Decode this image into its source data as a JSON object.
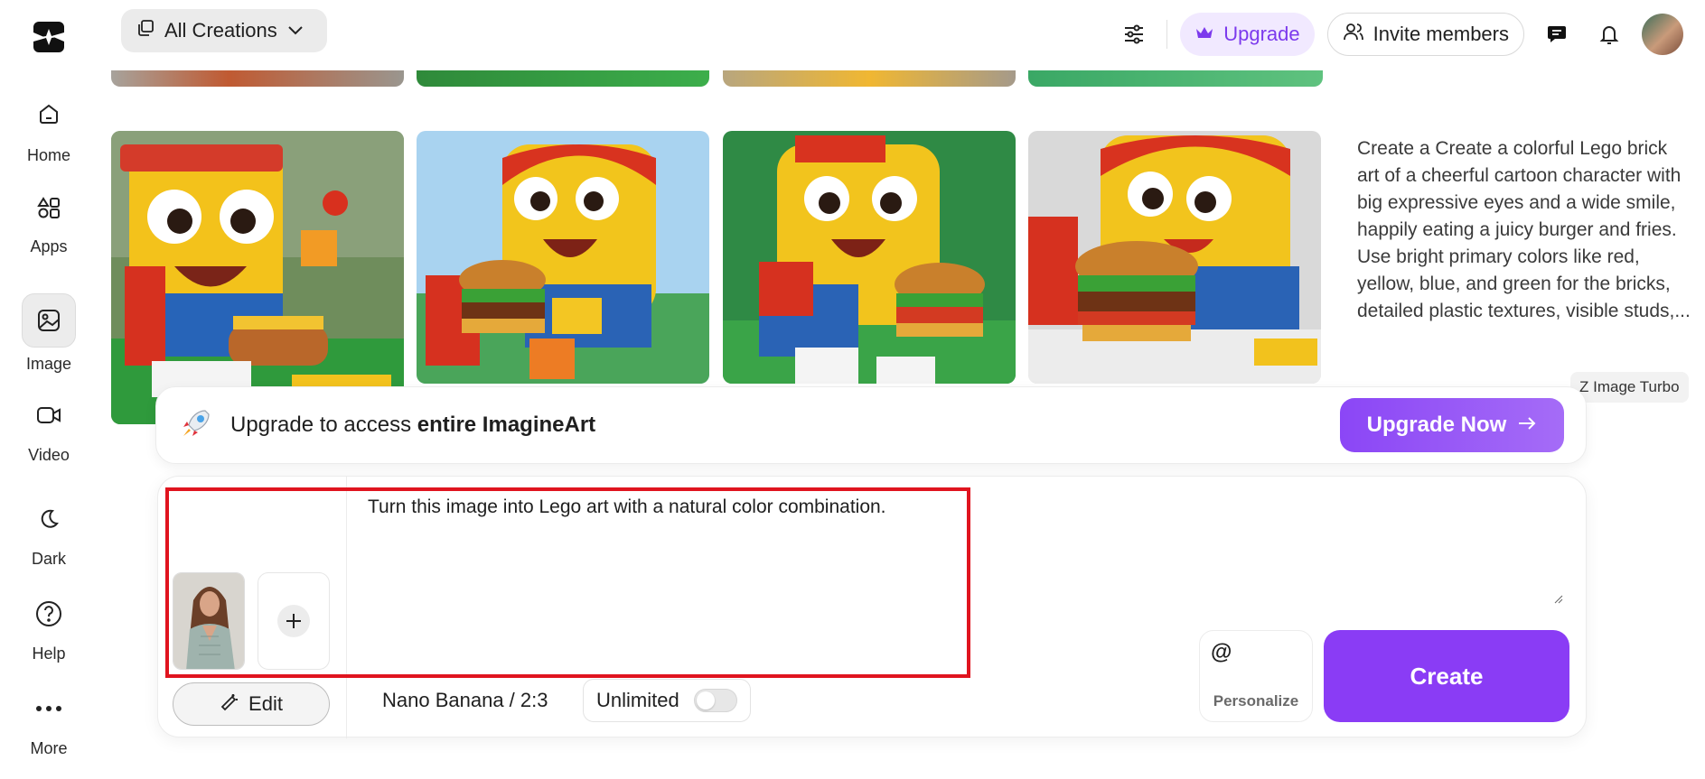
{
  "sidebar": {
    "items": [
      {
        "label": "Home",
        "icon": "home-icon"
      },
      {
        "label": "Apps",
        "icon": "apps-icon"
      },
      {
        "label": "Image",
        "icon": "image-icon",
        "active": true
      },
      {
        "label": "Video",
        "icon": "video-icon"
      },
      {
        "label": "Dark",
        "icon": "moon-icon"
      },
      {
        "label": "Help",
        "icon": "help-icon"
      },
      {
        "label": "More",
        "icon": "more-icon"
      }
    ]
  },
  "topbar": {
    "creations_label": "All Creations",
    "upgrade_label": "Upgrade",
    "invite_label": "Invite members"
  },
  "gallery": {
    "prompt": "Create a Create a colorful Lego brick art of a cheerful cartoon character with big expressive eyes and a wide smile, happily eating a juicy burger and fries. Use bright primary colors like red, yellow, blue, and green for the bricks, detailed plastic textures, visible studs,...",
    "model_tag": "Z Image Turbo"
  },
  "banner": {
    "text_prefix": "Upgrade to access ",
    "text_bold": "entire ImagineArt",
    "button_label": "Upgrade Now"
  },
  "composer": {
    "prompt_value": "Turn this image into Lego art with a natural color combination.",
    "edit_label": "Edit",
    "model_label": "Nano Banana / 2:3",
    "unlimited_label": "Unlimited",
    "personalize_symbol": "@",
    "personalize_label": "Personalize",
    "create_label": "Create"
  },
  "colors": {
    "accent": "#8a3cf5",
    "highlight": "#e0141f"
  }
}
